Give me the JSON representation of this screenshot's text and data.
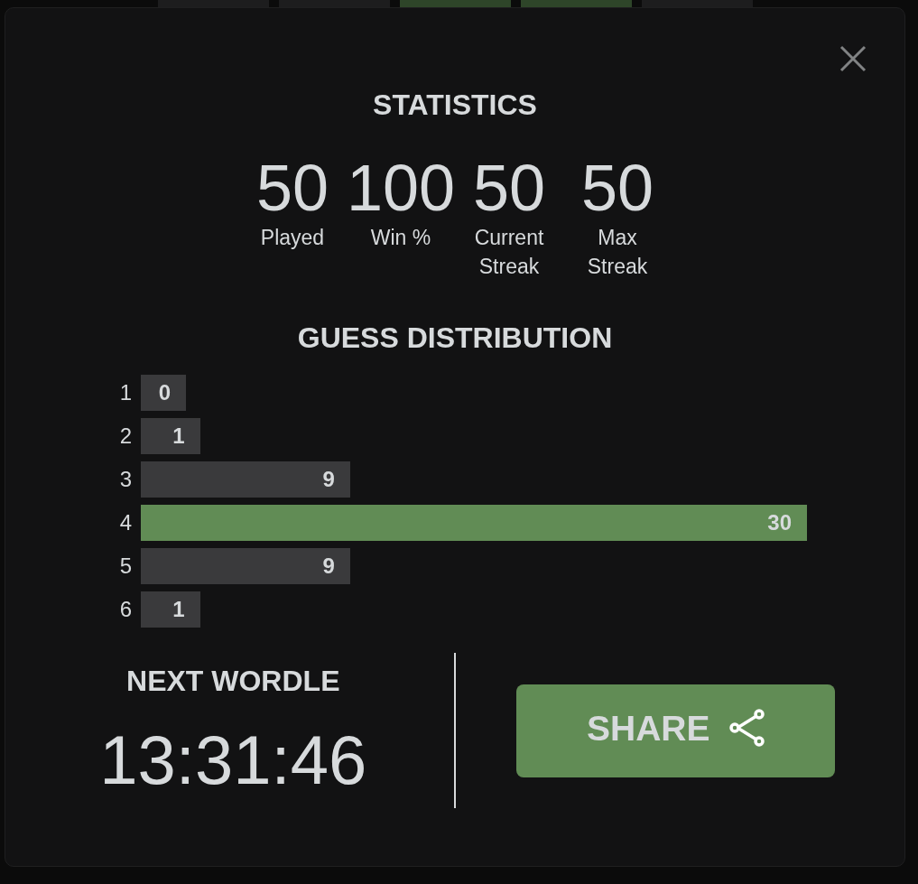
{
  "board_tiles": [
    {
      "color": "#1d1d1e"
    },
    {
      "color": "#1d1d1e"
    },
    {
      "color": "#2e4529"
    },
    {
      "color": "#2e4529"
    },
    {
      "color": "#1d1d1e"
    }
  ],
  "modal": {
    "title": "STATISTICS",
    "stats": [
      {
        "value": "50",
        "label": "Played"
      },
      {
        "value": "100",
        "label": "Win %"
      },
      {
        "value": "50",
        "label": "Current Streak"
      },
      {
        "value": "50",
        "label": "Max Streak"
      }
    ],
    "distribution": {
      "title": "GUESS DISTRIBUTION",
      "rows": [
        {
          "guess": "1",
          "count": "0",
          "highlighted": false
        },
        {
          "guess": "2",
          "count": "1",
          "highlighted": false
        },
        {
          "guess": "3",
          "count": "9",
          "highlighted": false
        },
        {
          "guess": "4",
          "count": "30",
          "highlighted": true
        },
        {
          "guess": "5",
          "count": "9",
          "highlighted": false
        },
        {
          "guess": "6",
          "count": "1",
          "highlighted": false
        }
      ]
    },
    "next_title": "NEXT WORDLE",
    "countdown": "13:31:46",
    "share_button": "SHARE"
  }
}
